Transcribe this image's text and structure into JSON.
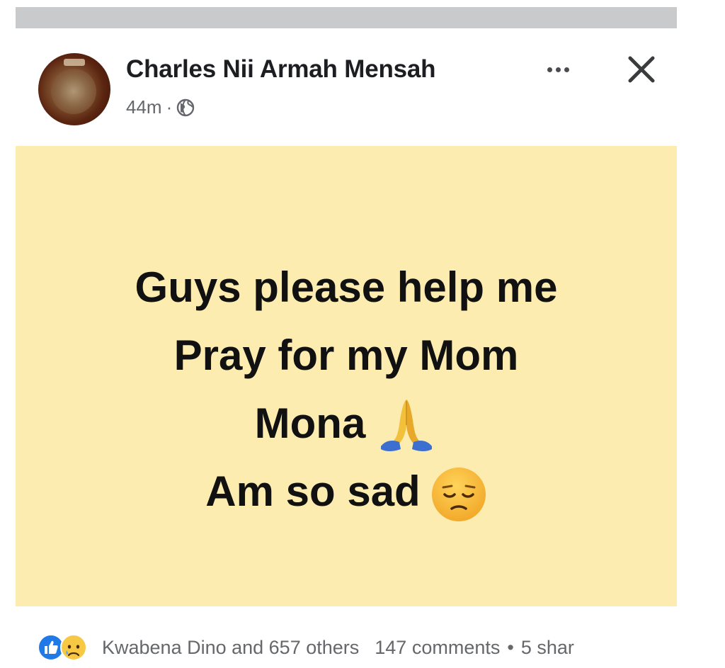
{
  "post": {
    "author": "Charles Nii Armah Mensah",
    "time": "44m",
    "separator": "·",
    "privacy_icon": "globe-icon",
    "more_icon": "more-horizontal-icon",
    "close_icon": "close-icon",
    "background_color": "#fcecb0",
    "text_lines": [
      "Guys please help me",
      "Pray for my Mom",
      "Mona",
      "Am so sad"
    ],
    "emojis": {
      "line_3": "folded-hands-emoji",
      "line_4": "pensive-face-emoji"
    }
  },
  "footer": {
    "reaction_icons": [
      "like-icon",
      "sad-icon"
    ],
    "reactions_text": "Kwabena Dino and 657 others",
    "comments_text": "147 comments",
    "separator": "•",
    "shares_text": "5 shar"
  }
}
